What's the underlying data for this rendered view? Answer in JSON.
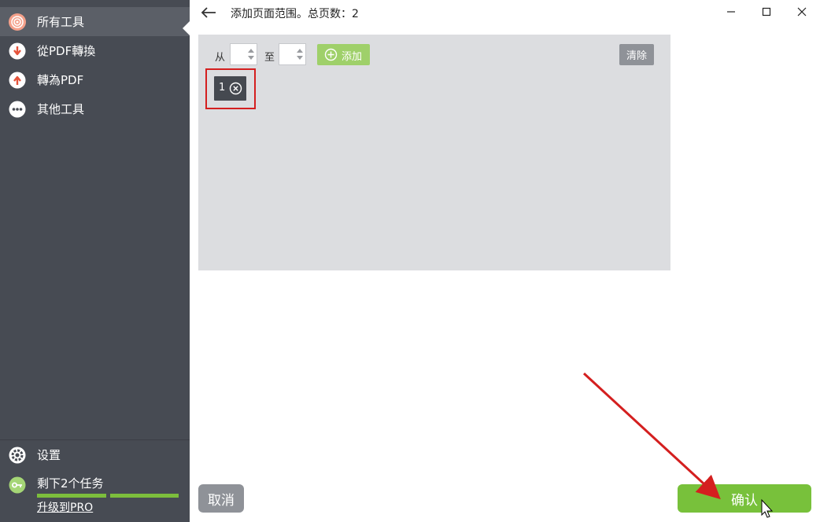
{
  "sidebar": {
    "items": [
      {
        "label": "所有工具",
        "icon": "all-tools-icon",
        "active": true
      },
      {
        "label": "從PDF轉換",
        "icon": "convert-from-pdf-icon",
        "active": false
      },
      {
        "label": "轉為PDF",
        "icon": "convert-to-pdf-icon",
        "active": false
      },
      {
        "label": "其他工具",
        "icon": "more-tools-icon",
        "active": false
      }
    ],
    "settings_label": "设置",
    "tasks_label": "剩下2个任务",
    "tasks_progress": 1.0,
    "upgrade_label": "升级到PRO"
  },
  "header": {
    "title": "添加页面范围。总页数：2"
  },
  "range_panel": {
    "from_label": "从",
    "to_label": "至",
    "from_value": "",
    "to_value": "",
    "add_label": "添加",
    "clear_label": "清除",
    "ranges": [
      "1"
    ]
  },
  "footer": {
    "cancel_label": "取消",
    "confirm_label": "确认"
  },
  "colors": {
    "sidebar_bg": "#474b53",
    "accent_green": "#78c13b",
    "panel_bg": "#dcdde0",
    "annotation_red": "#d41f1f"
  }
}
